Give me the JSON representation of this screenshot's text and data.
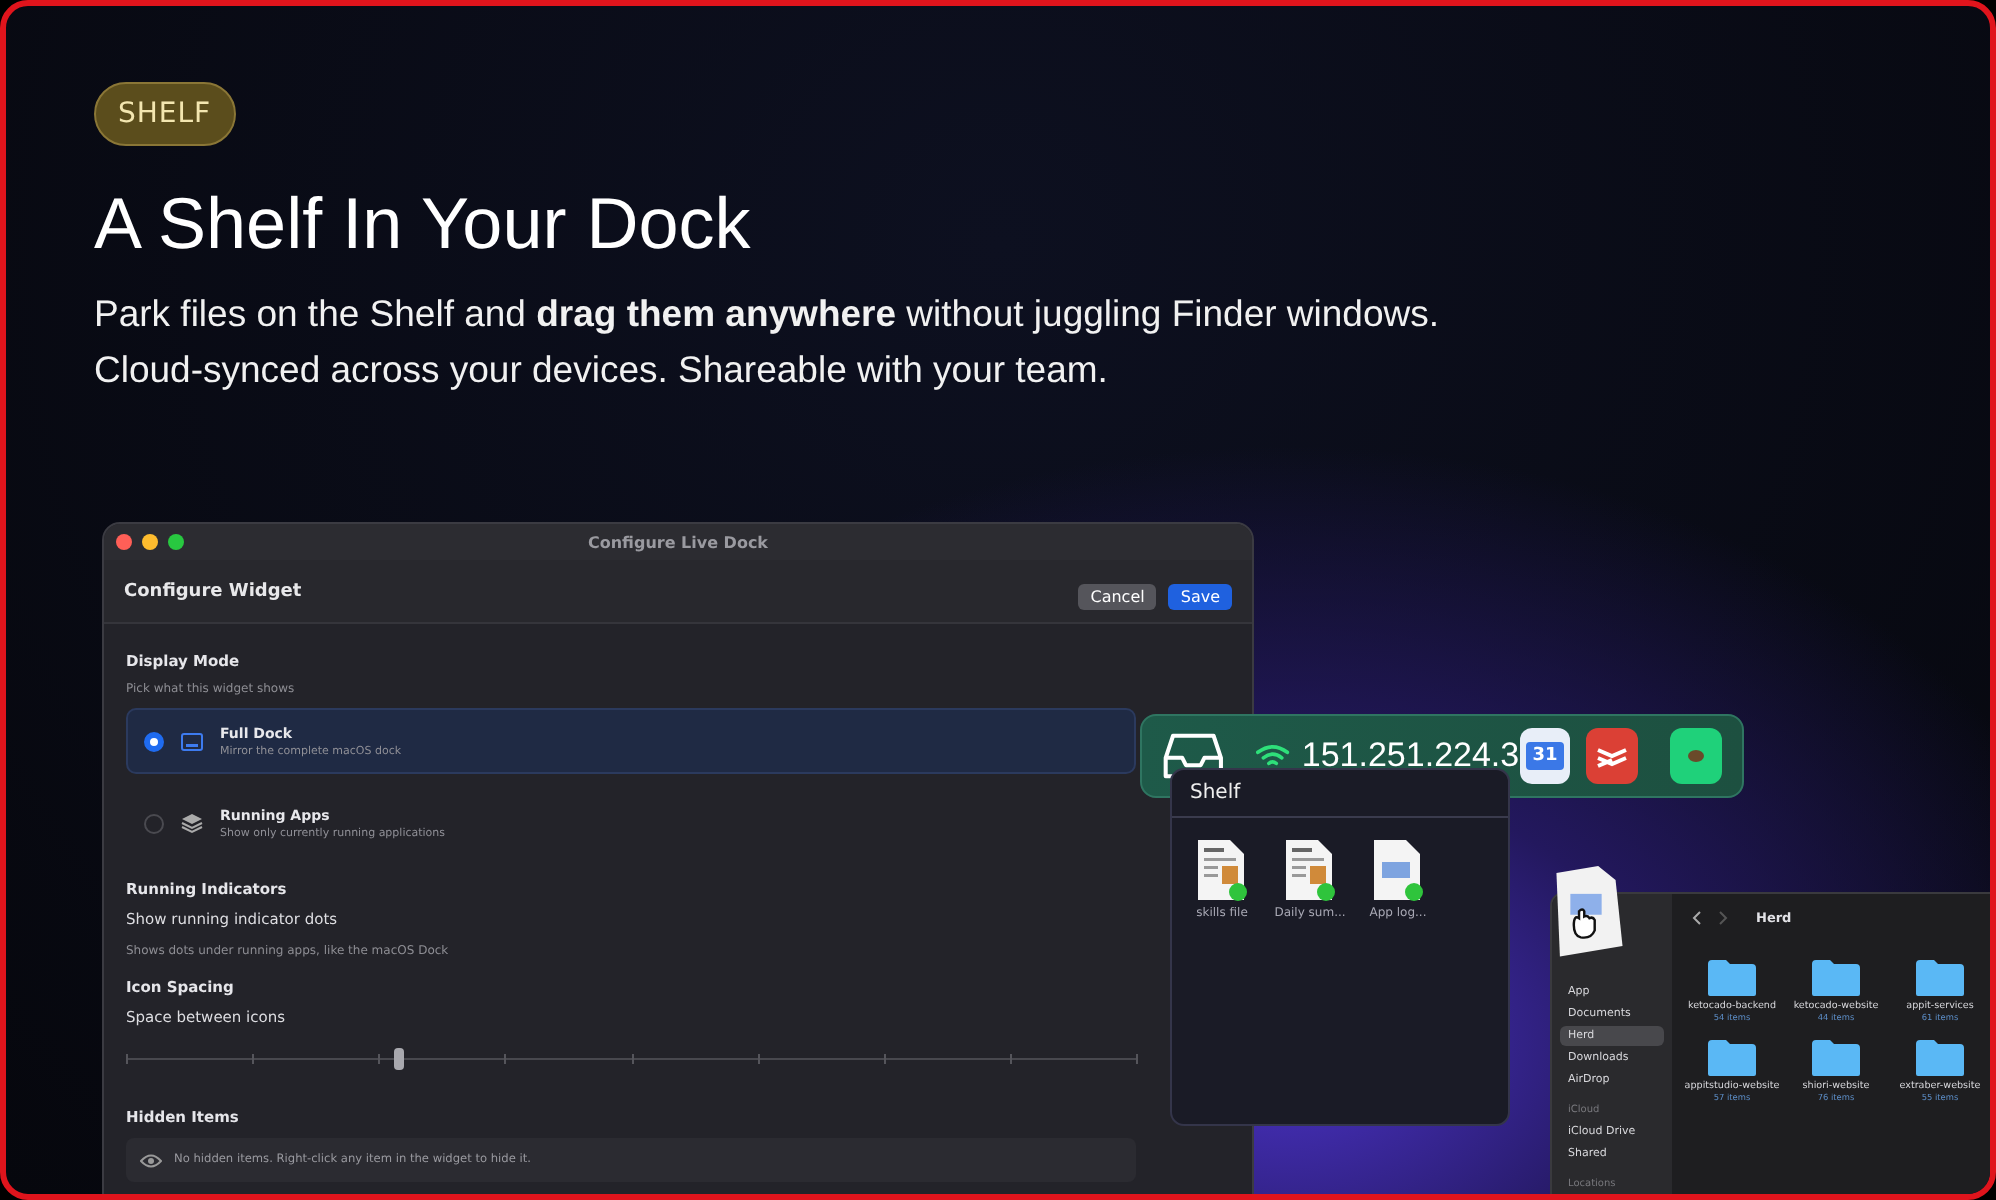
{
  "badge": "SHELF",
  "title": "A Shelf In Your Dock",
  "subtitle": [
    "Park files on the Shelf and **drag them anywhere** without juggling Finder windows.",
    "Cloud-synced across your devices. Shareable with your team."
  ],
  "config_window": {
    "title": "Configure Live Dock",
    "header": "Configure Widget",
    "buttons": [
      {
        "label": "Cancel",
        "kind": "secondary"
      },
      {
        "label": "Save",
        "kind": "primary"
      }
    ],
    "display_mode": {
      "heading": "Display Mode",
      "hint": "Pick what this widget shows",
      "options": [
        {
          "title": "Full Dock",
          "description": "Mirror the complete macOS dock",
          "selected": true,
          "kind": "dock"
        },
        {
          "title": "Running Apps",
          "description": "Show only currently running applications",
          "selected": false,
          "kind": "stack"
        }
      ]
    },
    "running_indicators": {
      "heading": "Running Indicators",
      "label": "Show running indicator dots",
      "hint": "Shows dots under running apps, like the macOS Dock"
    },
    "icon_spacing": {
      "heading": "Icon Spacing",
      "label": "Space between icons",
      "level": 0.27
    },
    "hidden_items": {
      "heading": "Hidden Items",
      "message": "No hidden items. Right-click any item in the widget to hide it."
    }
  },
  "dock": {
    "ip": "151.251.224.3",
    "calendar_day": "31"
  },
  "shelf": {
    "title": "Shelf",
    "files": [
      {
        "name": "skills file",
        "kind": "doc"
      },
      {
        "name": "Daily sum...",
        "kind": "doc"
      },
      {
        "name": "App log...",
        "kind": "image"
      }
    ]
  },
  "finder": {
    "location": "Herd",
    "sidebar": [
      {
        "items": [
          {
            "label": "App",
            "selected": false
          },
          {
            "label": "Documents",
            "selected": false
          },
          {
            "label": "Herd",
            "selected": true
          },
          {
            "label": "Downloads",
            "selected": false
          },
          {
            "label": "AirDrop",
            "selected": false
          }
        ]
      },
      {
        "heading": "iCloud",
        "items": [
          {
            "label": "iCloud Drive",
            "selected": false
          },
          {
            "label": "Shared",
            "selected": false
          }
        ]
      },
      {
        "heading": "Locations"
      }
    ],
    "folders": [
      {
        "name": "ketocado-backend",
        "count": "54 items"
      },
      {
        "name": "ketocado-website",
        "count": "44 items"
      },
      {
        "name": "appit-services",
        "count": "61 items"
      },
      {
        "name": "appitstudio-website",
        "count": "57 items"
      },
      {
        "name": "shiori-website",
        "count": "76 items"
      },
      {
        "name": "extraber-website",
        "count": "55 items"
      }
    ]
  }
}
